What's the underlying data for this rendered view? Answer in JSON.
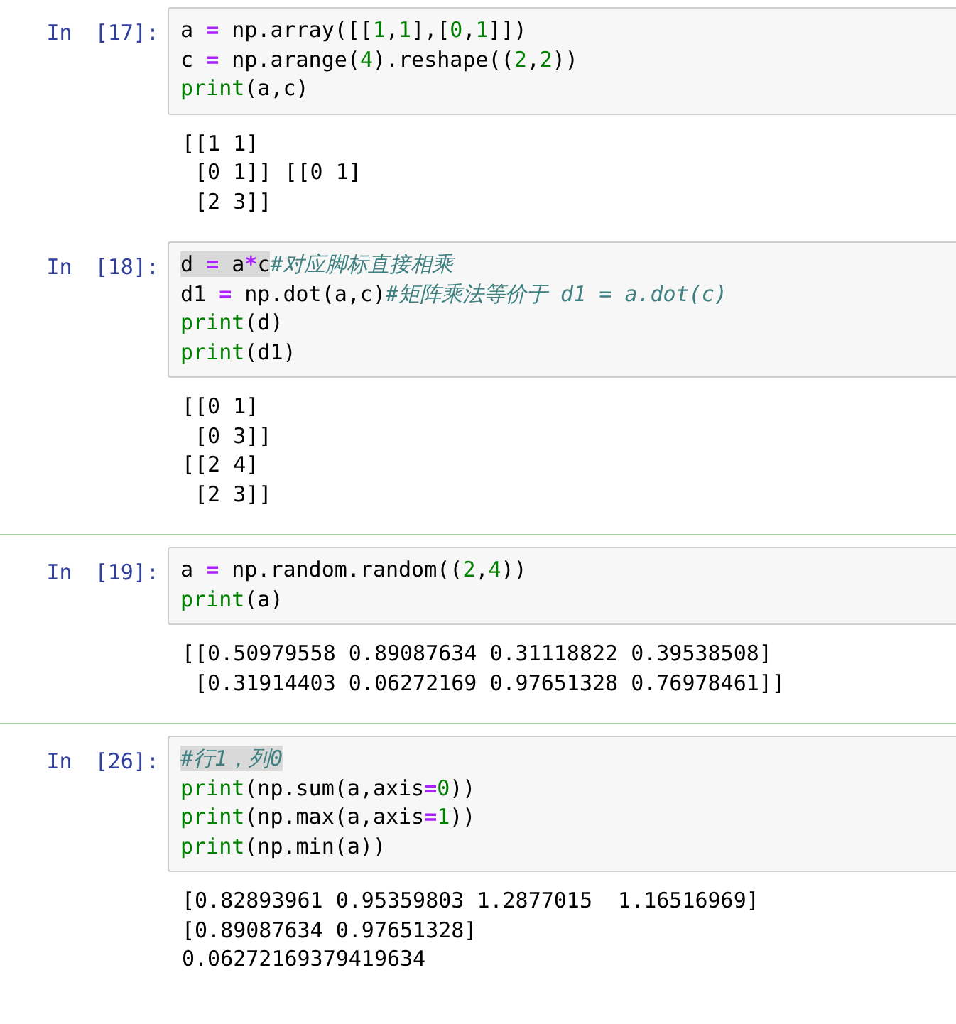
{
  "cells": [
    {
      "prompt": "In",
      "number": "[17]:",
      "separated": false,
      "code": [
        {
          "segments": [
            {
              "highlighted": false,
              "tokens": [
                {
                  "kind": "plain",
                  "text": "a "
                },
                {
                  "kind": "op",
                  "text": "="
                },
                {
                  "kind": "plain",
                  "text": " np.array([["
                },
                {
                  "kind": "num",
                  "text": "1"
                },
                {
                  "kind": "plain",
                  "text": ","
                },
                {
                  "kind": "num",
                  "text": "1"
                },
                {
                  "kind": "plain",
                  "text": "],["
                },
                {
                  "kind": "num",
                  "text": "0"
                },
                {
                  "kind": "plain",
                  "text": ","
                },
                {
                  "kind": "num",
                  "text": "1"
                },
                {
                  "kind": "plain",
                  "text": "]])"
                }
              ]
            }
          ]
        },
        {
          "segments": [
            {
              "highlighted": false,
              "tokens": [
                {
                  "kind": "plain",
                  "text": "c "
                },
                {
                  "kind": "op",
                  "text": "="
                },
                {
                  "kind": "plain",
                  "text": " np.arange("
                },
                {
                  "kind": "num",
                  "text": "4"
                },
                {
                  "kind": "plain",
                  "text": ").reshape(("
                },
                {
                  "kind": "num",
                  "text": "2"
                },
                {
                  "kind": "plain",
                  "text": ","
                },
                {
                  "kind": "num",
                  "text": "2"
                },
                {
                  "kind": "plain",
                  "text": "))"
                }
              ]
            }
          ]
        },
        {
          "segments": [
            {
              "highlighted": false,
              "tokens": [
                {
                  "kind": "builtin",
                  "text": "print"
                },
                {
                  "kind": "plain",
                  "text": "(a,c)"
                }
              ]
            }
          ]
        }
      ],
      "output": "[[1 1]\n [0 1]] [[0 1]\n [2 3]]"
    },
    {
      "prompt": "In",
      "number": "[18]:",
      "separated": false,
      "code": [
        {
          "segments": [
            {
              "highlighted": true,
              "tokens": [
                {
                  "kind": "plain",
                  "text": "d "
                },
                {
                  "kind": "op",
                  "text": "="
                },
                {
                  "kind": "plain",
                  "text": " a"
                },
                {
                  "kind": "op",
                  "text": "*"
                },
                {
                  "kind": "plain",
                  "text": "c"
                }
              ]
            },
            {
              "highlighted": false,
              "tokens": [
                {
                  "kind": "comment",
                  "text": "#对应脚标直接相乘"
                }
              ]
            }
          ]
        },
        {
          "segments": [
            {
              "highlighted": false,
              "tokens": [
                {
                  "kind": "plain",
                  "text": "d1 "
                },
                {
                  "kind": "op",
                  "text": "="
                },
                {
                  "kind": "plain",
                  "text": " np.dot(a,c)"
                },
                {
                  "kind": "comment",
                  "text": "#矩阵乘法等价于 d1 = a.dot(c)"
                }
              ]
            }
          ]
        },
        {
          "segments": [
            {
              "highlighted": false,
              "tokens": [
                {
                  "kind": "builtin",
                  "text": "print"
                },
                {
                  "kind": "plain",
                  "text": "(d)"
                }
              ]
            }
          ]
        },
        {
          "segments": [
            {
              "highlighted": false,
              "tokens": [
                {
                  "kind": "builtin",
                  "text": "print"
                },
                {
                  "kind": "plain",
                  "text": "(d1)"
                }
              ]
            }
          ]
        }
      ],
      "output": "[[0 1]\n [0 3]]\n[[2 4]\n [2 3]]"
    },
    {
      "prompt": "In",
      "number": "[19]:",
      "separated": true,
      "code": [
        {
          "segments": [
            {
              "highlighted": false,
              "tokens": [
                {
                  "kind": "plain",
                  "text": "a "
                },
                {
                  "kind": "op",
                  "text": "="
                },
                {
                  "kind": "plain",
                  "text": " np.random.random(("
                },
                {
                  "kind": "num",
                  "text": "2"
                },
                {
                  "kind": "plain",
                  "text": ","
                },
                {
                  "kind": "num",
                  "text": "4"
                },
                {
                  "kind": "plain",
                  "text": "))"
                }
              ]
            }
          ]
        },
        {
          "segments": [
            {
              "highlighted": false,
              "tokens": [
                {
                  "kind": "builtin",
                  "text": "print"
                },
                {
                  "kind": "plain",
                  "text": "(a)"
                }
              ]
            }
          ]
        }
      ],
      "output": "[[0.50979558 0.89087634 0.31118822 0.39538508]\n [0.31914403 0.06272169 0.97651328 0.76978461]]"
    },
    {
      "prompt": "In",
      "number": "[26]:",
      "separated": true,
      "code": [
        {
          "segments": [
            {
              "highlighted": true,
              "tokens": [
                {
                  "kind": "comment",
                  "text": "#行1，列0"
                }
              ]
            }
          ]
        },
        {
          "segments": [
            {
              "highlighted": false,
              "tokens": [
                {
                  "kind": "builtin",
                  "text": "print"
                },
                {
                  "kind": "plain",
                  "text": "(np.sum(a,axis"
                },
                {
                  "kind": "op",
                  "text": "="
                },
                {
                  "kind": "num",
                  "text": "0"
                },
                {
                  "kind": "plain",
                  "text": "))"
                }
              ]
            }
          ]
        },
        {
          "segments": [
            {
              "highlighted": false,
              "tokens": [
                {
                  "kind": "builtin",
                  "text": "print"
                },
                {
                  "kind": "plain",
                  "text": "(np.max(a,axis"
                },
                {
                  "kind": "op",
                  "text": "="
                },
                {
                  "kind": "num",
                  "text": "1"
                },
                {
                  "kind": "plain",
                  "text": "))"
                }
              ]
            }
          ]
        },
        {
          "segments": [
            {
              "highlighted": false,
              "tokens": [
                {
                  "kind": "builtin",
                  "text": "print"
                },
                {
                  "kind": "plain",
                  "text": "(np.min(a))"
                }
              ]
            }
          ]
        }
      ],
      "output": "[0.82893961 0.95359803 1.2877015  1.16516969]\n[0.89087634 0.97651328]\n0.06272169379419634"
    }
  ]
}
